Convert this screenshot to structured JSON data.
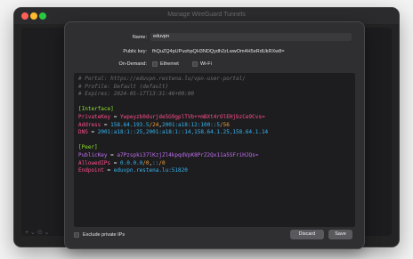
{
  "window": {
    "title": "Manage WireGuard Tunnels"
  },
  "form": {
    "name_label": "Name:",
    "name_value": "eduvpn",
    "pubkey_label": "Public key:",
    "pubkey_value": "fhQuZQ4pUPuohpQH3NDQydh2zLwwOm4H5eRdUkRXw8=",
    "ondemand_label": "On-Demand:",
    "ethernet_label": "Ethernet",
    "wifi_label": "Wi-Fi"
  },
  "config": {
    "comments": [
      "# Portal: https://eduvpn.restena.lu/vpn-user-portal/",
      "# Profile: Default (default)",
      "# Expires: 2024-05-17T13:31:46+00:00"
    ],
    "interface_header": "[Interface]",
    "private_key_name": "PrivateKey",
    "private_key_value": "Ywpeyzb0durjde5G9gplTVb++mBXt4rOlEHjbzCe9Cvs=",
    "address_name": "Address",
    "address_ip4": "158.64.193.5",
    "address_mask4": "/24",
    "address_sep": ",",
    "address_ip6": "2001:a18:12:100::5",
    "address_mask6": "/56",
    "dns_name": "DNS",
    "dns_value": "2001:a18:1::25,2001:a18:1::14,158.64.1.25,158.64.1.14",
    "peer_header": "[Peer]",
    "peer_pubkey_name": "PublicKey",
    "peer_pubkey_value": "a7Pzspki37lKzjZl4kpqdVpK8PrZ2Qx11a5SFriHJQs=",
    "allowed_ips_name": "AllowedIPs",
    "allowed_ips_a": "0.0.0.0",
    "allowed_ips_a_mask": "/0",
    "allowed_ips_sep": ",",
    "allowed_ips_b": "::",
    "allowed_ips_b_mask": "/0",
    "endpoint_name": "Endpoint",
    "endpoint_value": "eduvpn.restena.lu:51820",
    "equals": "="
  },
  "footer": {
    "exclude_label": "Exclude private IPs",
    "discard_label": "Discard",
    "save_label": "Save"
  },
  "bottombar": {
    "controls": "+ ⌄ ⊙ ⌄"
  },
  "colors": {
    "accent_green": "#8be12c",
    "key_pink": "#ff4d8a",
    "value_blue": "#36b5f0",
    "number_orange": "#f0a13a"
  }
}
